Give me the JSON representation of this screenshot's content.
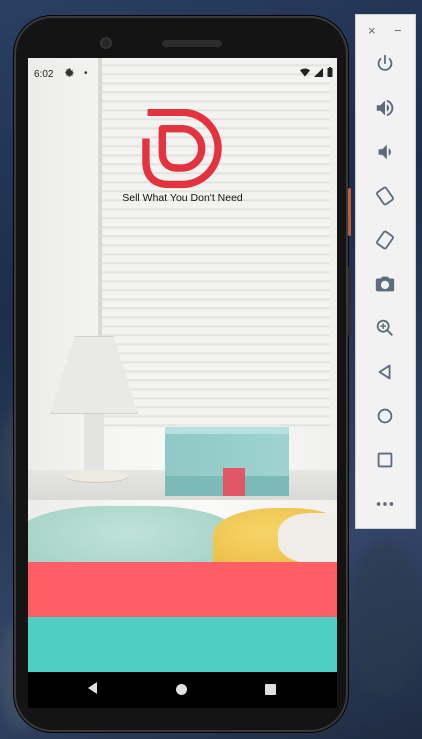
{
  "status": {
    "time": "6:02"
  },
  "app": {
    "tagline": "Sell What You Don't Need"
  },
  "colors": {
    "coral": "#fe5e65",
    "teal": "#4ecfc4",
    "brand_red": "#e2333f"
  },
  "emulator_panel": {
    "icons": [
      "close-icon",
      "minimize-icon",
      "power-icon",
      "volume-up-icon",
      "volume-down-icon",
      "rotate-left-icon",
      "rotate-right-icon",
      "camera-icon",
      "zoom-icon",
      "back-icon",
      "home-icon",
      "overview-icon",
      "more-icon"
    ],
    "close_glyph": "×",
    "minimize_glyph": "−"
  }
}
